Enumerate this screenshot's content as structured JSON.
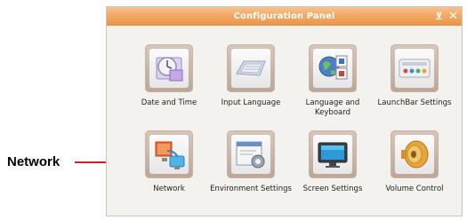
{
  "callout": {
    "label": "Network",
    "line_color": "#d0202a"
  },
  "window": {
    "title": "Configuration Panel",
    "title_color": "#f3a964",
    "minimize_glyph": "⊻",
    "close_glyph": "✕"
  },
  "items": [
    {
      "label": "Date and Time",
      "icon": "date-time-icon"
    },
    {
      "label": "Input Language",
      "icon": "keyboard-icon"
    },
    {
      "label": "Language and Keyboard",
      "icon": "language-keyboard-icon"
    },
    {
      "label": "LaunchBar Settings",
      "icon": "launchbar-icon"
    },
    {
      "label": "Network",
      "icon": "network-icon"
    },
    {
      "label": "Environment Settings",
      "icon": "environment-settings-icon"
    },
    {
      "label": "Screen Settings",
      "icon": "monitor-icon"
    },
    {
      "label": "Volume Control",
      "icon": "speaker-icon"
    }
  ]
}
